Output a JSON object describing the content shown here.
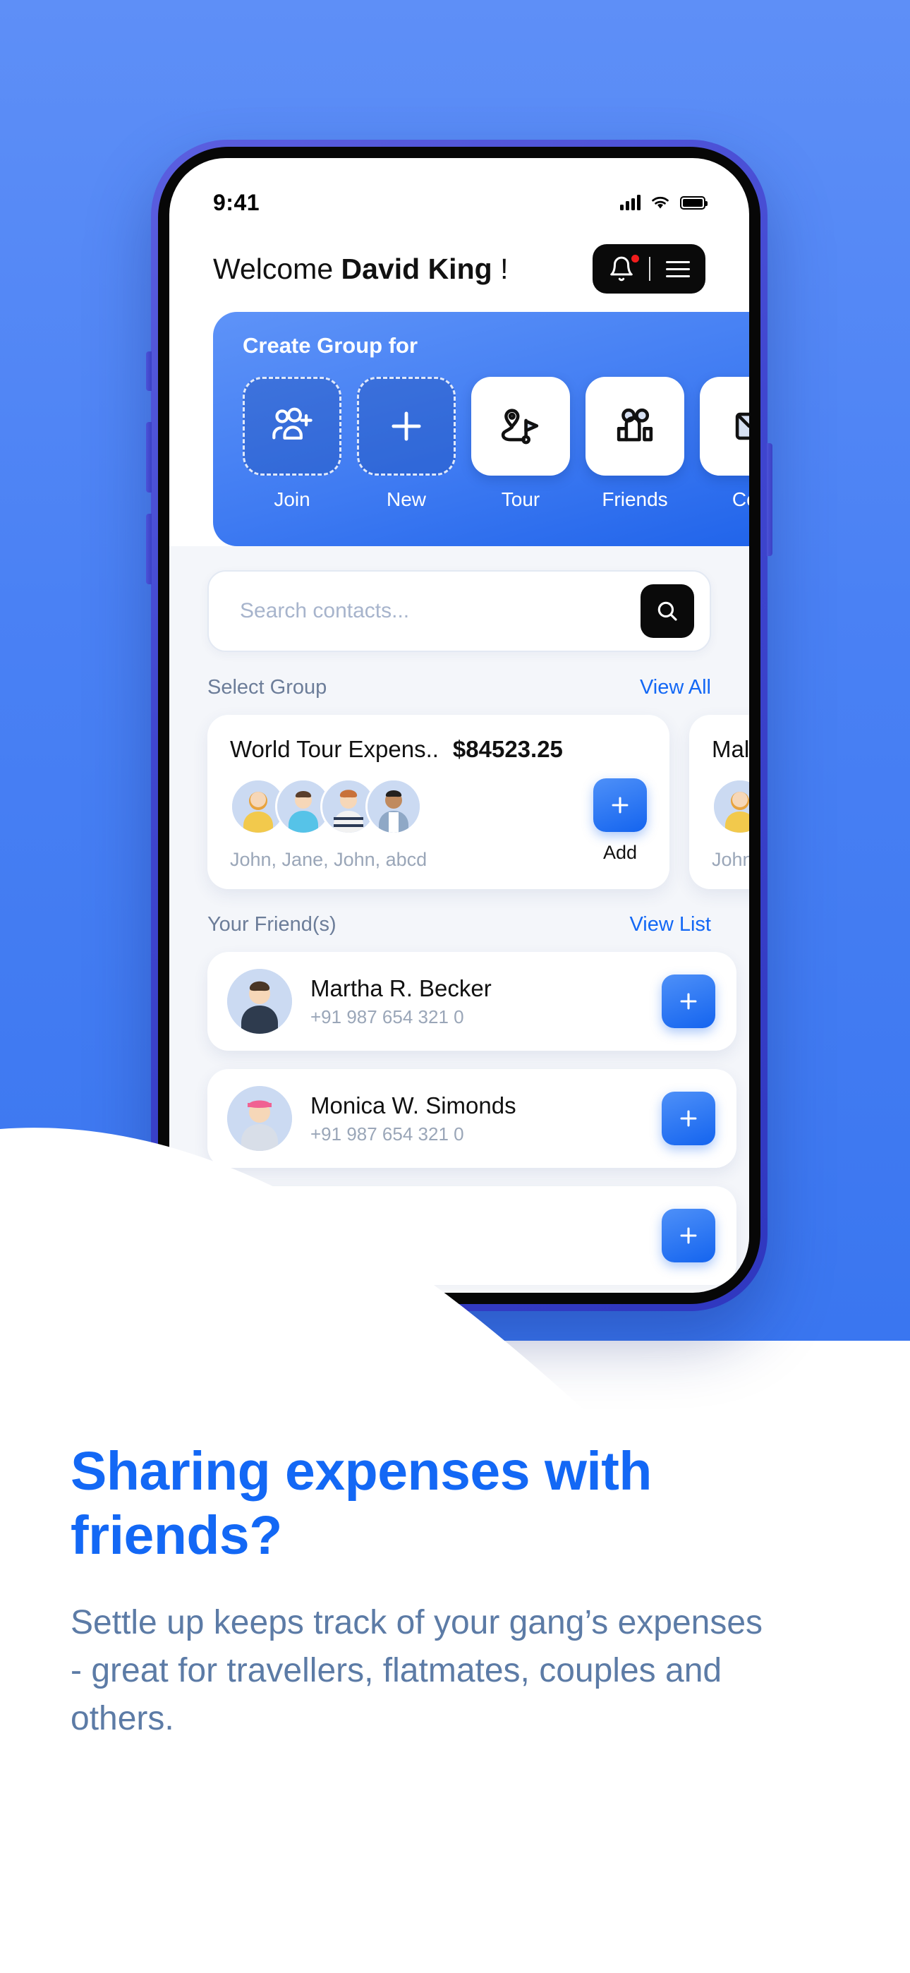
{
  "background": {
    "gradient_top": "#5E8FF7",
    "gradient_bottom": "#3A76F0"
  },
  "phone": {
    "status_bar": {
      "time": "9:41",
      "signal_icon": "cellular-bars-icon",
      "wifi_icon": "wifi-icon",
      "battery_icon": "battery-full-icon"
    },
    "header": {
      "welcome_prefix": "Welcome ",
      "user_name": "David King",
      "welcome_suffix": " !",
      "notification_icon": "bell-icon",
      "menu_icon": "hamburger-menu-icon",
      "badge_color": "#f11d1d"
    },
    "create_group": {
      "title": "Create Group for",
      "tiles": [
        {
          "label": "Join",
          "icon": "people-add-icon",
          "style": "dashed"
        },
        {
          "label": "New",
          "icon": "plus-icon",
          "style": "dashed"
        },
        {
          "label": "Tour",
          "icon": "route-flag-icon",
          "style": "white"
        },
        {
          "label": "Friends",
          "icon": "two-people-icon",
          "style": "white"
        },
        {
          "label": "Coll",
          "icon": "collection-icon",
          "style": "white"
        }
      ]
    },
    "search": {
      "placeholder": "Search contacts...",
      "value": "",
      "icon": "search-icon"
    },
    "select_group": {
      "title": "Select Group",
      "view_all": "View All",
      "cards": [
        {
          "name": "World Tour Expens..",
          "amount": "$84523.25",
          "members": "John, Jane, John, abcd",
          "avatar_count": 4,
          "add_label": "Add",
          "add_icon": "plus-icon"
        },
        {
          "name": "Maldives",
          "amount": "",
          "members": "John, Jane",
          "avatar_count": 2,
          "add_label": "",
          "add_icon": "plus-icon"
        }
      ]
    },
    "friends": {
      "title": "Your Friend(s)",
      "view_list": "View List",
      "rows": [
        {
          "name": "Martha R. Becker",
          "phone": "+91 987 654 321 0",
          "add_icon": "plus-icon"
        },
        {
          "name": "Monica W. Simonds",
          "phone": "+91 987 654 321 0",
          "add_icon": "plus-icon"
        },
        {
          "name": "",
          "phone": "",
          "add_icon": "plus-icon"
        }
      ]
    }
  },
  "promo": {
    "headline": "Sharing expenses with friends?",
    "body": "Settle up keeps track of your gang’s expenses - great for travellers, flatmates, couples and others.",
    "headline_color": "#1368F5",
    "body_color": "#5C7BA6"
  }
}
